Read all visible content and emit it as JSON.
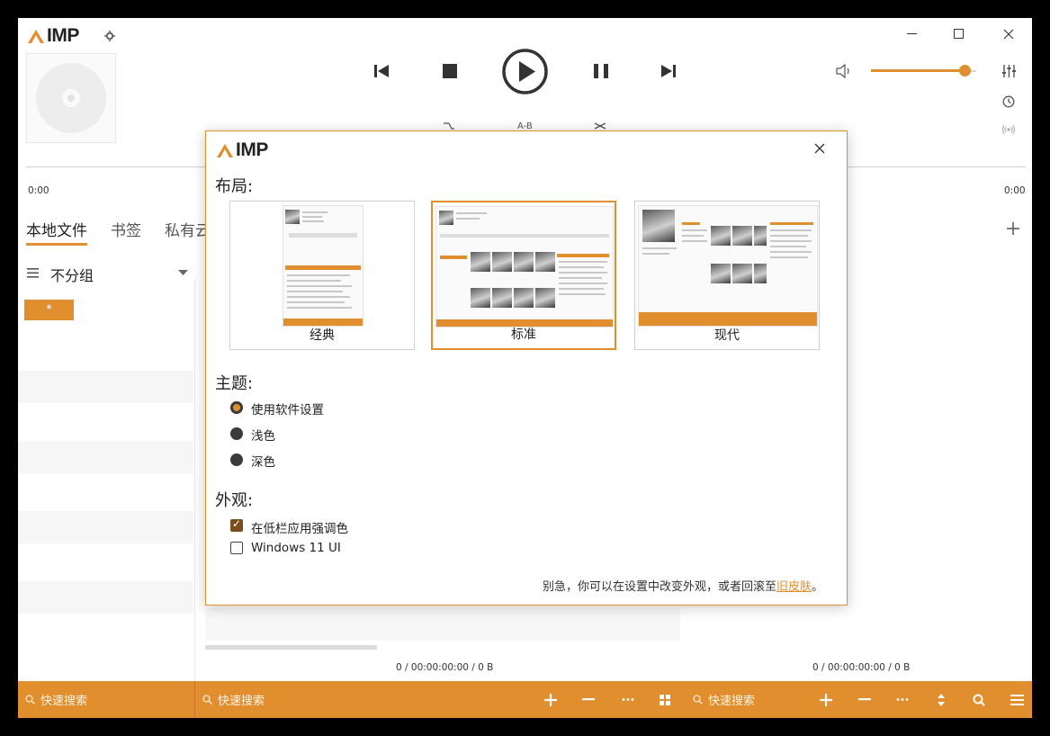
{
  "app": {
    "logo_text": "IMP",
    "accent_color": "#e18e2e"
  },
  "window_controls": {
    "minimize_icon": "minimize-icon",
    "maximize_icon": "maximize-icon",
    "close_icon": "close-icon"
  },
  "player": {
    "time_elapsed": "0:00",
    "time_total": "0:00",
    "ab_label": "A-B",
    "volume_percent": 89
  },
  "tabs": [
    {
      "label": "本地文件",
      "active": true
    },
    {
      "label": "书签",
      "active": false
    },
    {
      "label": "私有云",
      "active": false
    }
  ],
  "group": {
    "label": "不分组",
    "filter_label": "*"
  },
  "status": {
    "left": "0 / 00:00:00:00 / 0 B",
    "right": "0 / 00:00:00:00 / 0 B"
  },
  "search": {
    "placeholder_1": "快速搜索",
    "placeholder_2": "快速搜索",
    "placeholder_3": "快速搜索"
  },
  "dialog": {
    "logo_text": "IMP",
    "layout_heading": "布局:",
    "layouts": [
      {
        "label": "经典",
        "selected": false
      },
      {
        "label": "标准",
        "selected": true
      },
      {
        "label": "现代",
        "selected": false
      }
    ],
    "theme_heading": "主题:",
    "themes": [
      {
        "label": "使用软件设置",
        "selected": true
      },
      {
        "label": "浅色",
        "selected": false
      },
      {
        "label": "深色",
        "selected": false
      }
    ],
    "appearance_heading": "外观:",
    "appearance": [
      {
        "label": "在低栏应用强调色",
        "checked": true
      },
      {
        "label": "Windows 11 UI",
        "checked": false
      }
    ],
    "note_text": "别急，你可以在设置中改变外观，或者回滚至",
    "note_link": "旧皮肤",
    "note_end": "。"
  }
}
